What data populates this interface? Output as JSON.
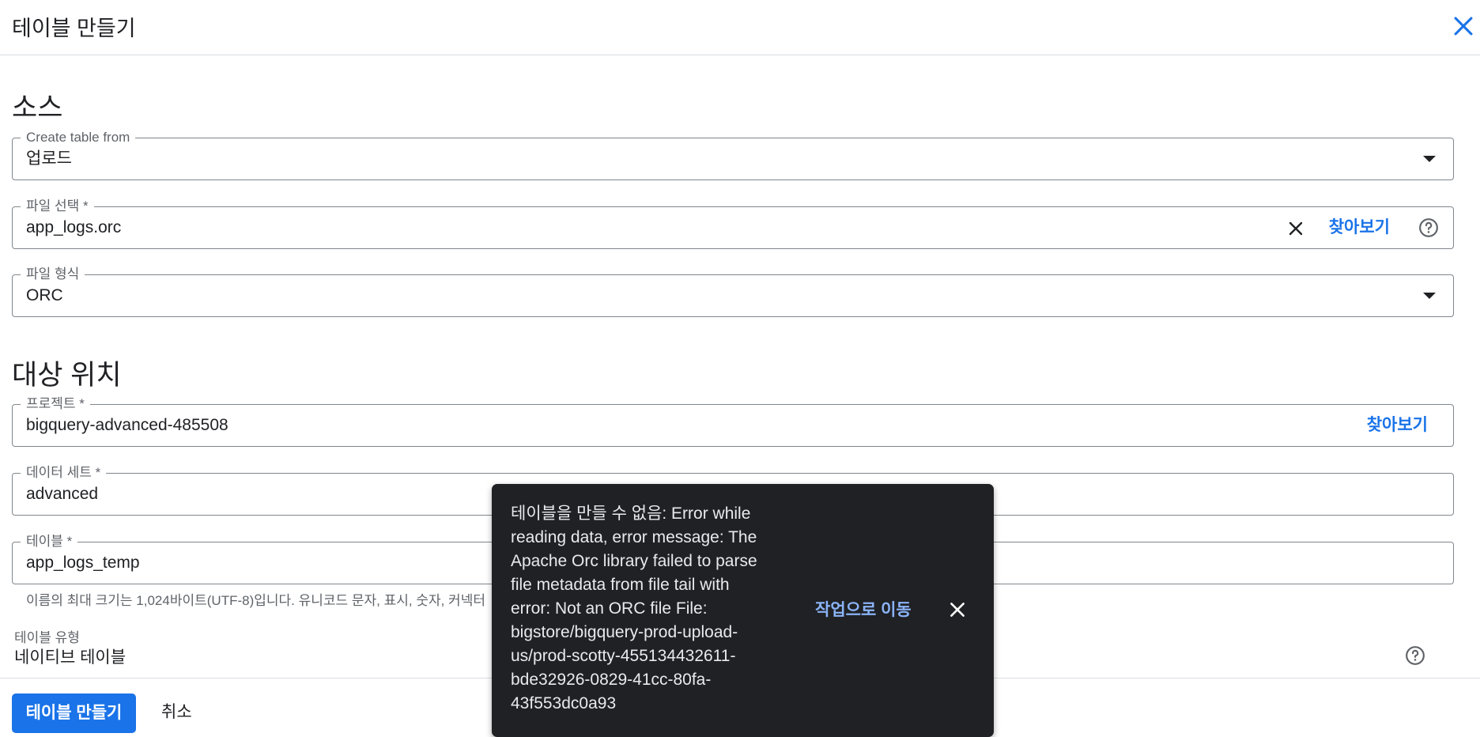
{
  "header": {
    "title": "테이블 만들기",
    "close_icon": "close-icon"
  },
  "source": {
    "title": "소스",
    "create_from": {
      "label": "Create table from",
      "value": "업로드"
    },
    "file_select": {
      "label": "파일 선택 *",
      "value": "app_logs.orc",
      "browse_label": "찾아보기",
      "clear_icon": "close-icon",
      "help_icon": "help-circle-icon"
    },
    "file_format": {
      "label": "파일 형식",
      "value": "ORC"
    }
  },
  "destination": {
    "title": "대상 위치",
    "project": {
      "label": "프로젝트 *",
      "value": "bigquery-advanced-485508",
      "browse_label": "찾아보기"
    },
    "dataset": {
      "label": "데이터 세트 *",
      "value": "advanced"
    },
    "table": {
      "label": "테이블 *",
      "value": "app_logs_temp",
      "hint": "이름의 최대 크기는 1,024바이트(UTF-8)입니다. 유니코드 문자, 표시, 숫자, 커넥터"
    },
    "table_type": {
      "label": "테이블 유형",
      "value": "네이티브 테이블",
      "help_icon": "help-circle-icon"
    }
  },
  "footer": {
    "create_label": "테이블 만들기",
    "cancel_label": "취소"
  },
  "snackbar": {
    "message": "테이블을 만들 수 없음: Error while reading data, error message: The Apache Orc library failed to parse file metadata from file tail with error: Not an ORC file File: bigstore/bigquery-prod-upload-us/prod-scotty-455134432611-bde32926-0829-41cc-80fa-43f553dc0a93",
    "action_label": "작업으로 이동",
    "close_icon": "close-icon"
  },
  "colors": {
    "accent": "#1a73e8",
    "snackbar_bg": "#202124",
    "snackbar_action": "#8ab4f8",
    "border": "#80868b"
  }
}
